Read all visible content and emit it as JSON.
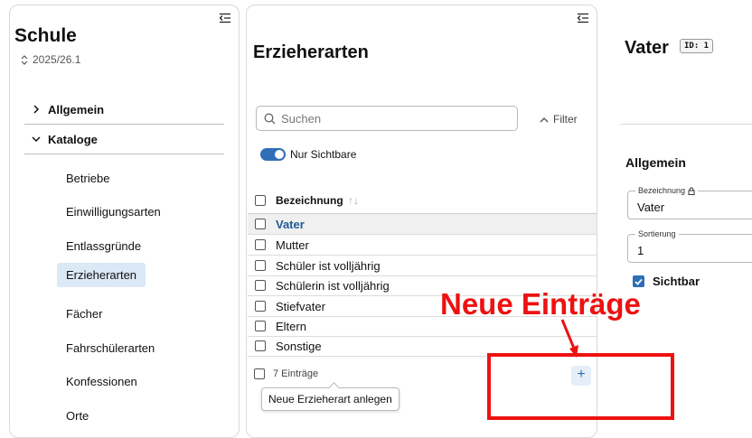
{
  "school": {
    "title": "Schule",
    "year": "2025/26.1"
  },
  "nav": {
    "sections": [
      {
        "label": "Allgemein",
        "expanded": false
      },
      {
        "label": "Kataloge",
        "expanded": true
      }
    ],
    "items": [
      {
        "label": "Betriebe",
        "active": false
      },
      {
        "label": "Einwilligungsarten",
        "active": false
      },
      {
        "label": "Entlassgründe",
        "active": false
      },
      {
        "label": "Erzieherarten",
        "active": true
      },
      {
        "label": "Fächer",
        "active": false
      },
      {
        "label": "Fahrschülerarten",
        "active": false
      },
      {
        "label": "Konfessionen",
        "active": false
      },
      {
        "label": "Orte",
        "active": false
      }
    ]
  },
  "list": {
    "title": "Erzieherarten",
    "search_placeholder": "Suchen",
    "filter_label": "Filter",
    "toggle_label": "Nur Sichtbare",
    "toggle_on": true,
    "column_header": "Bezeichnung",
    "rows": [
      "Vater",
      "Mutter",
      "Schüler ist volljährig",
      "Schülerin ist volljährig",
      "Stiefvater",
      "Eltern",
      "Sonstige"
    ],
    "selected_index": 0,
    "footer_count": "7 Einträge",
    "add_icon": "plus-icon",
    "add_tooltip": "Neue Erzieherart anlegen"
  },
  "detail": {
    "title": "Vater",
    "id_badge": "ID: 1",
    "section_title": "Allgemein",
    "fields": [
      {
        "label": "Bezeichnung",
        "value": "Vater",
        "locked": true
      },
      {
        "label": "Sortierung",
        "value": "1",
        "locked": false
      }
    ],
    "visible_label": "Sichtbar",
    "visible_checked": true
  },
  "annotation": {
    "label": "Neue Einträge",
    "color": "#ee1111"
  },
  "colors": {
    "accent": "#2f6fb5",
    "selected_text": "#1f5a99",
    "active_nav_bg": "#dbe8f5"
  }
}
